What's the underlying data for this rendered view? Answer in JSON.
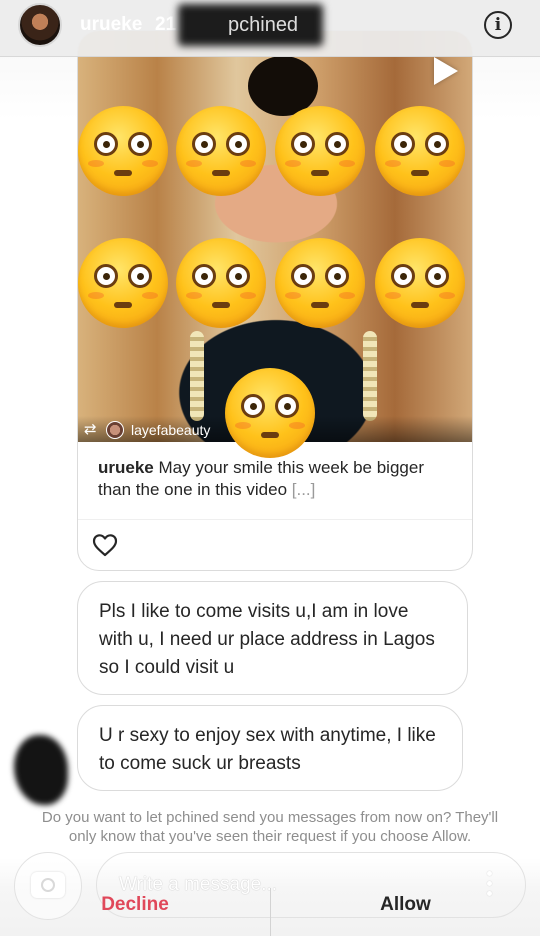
{
  "header": {
    "username": "urueke",
    "time": "21 h",
    "redacted_name": "pchined",
    "info_icon": "info-icon"
  },
  "post": {
    "repost_icon": "repost-icon",
    "reposted_from": "laуefabeauty",
    "caption_user": "urueke",
    "caption_text": "May your smile this week be bigger than the one in this video",
    "caption_more": "[...]",
    "overlay_emoji": "flushed-face-emoji",
    "overlay_emoji_count": 9
  },
  "messages": [
    {
      "text": "Pls I like to come visits u,I am in love with u, I need ur place address in Lagos so I could visit u"
    },
    {
      "text": "U r sexy to enjoy sex with anytime, I like to come suck ur breasts"
    }
  ],
  "request": {
    "prompt": "Do you want to let pchined send you messages from now on? They'll only know that you've seen their request if you choose Allow.",
    "decline_label": "Decline",
    "allow_label": "Allow"
  },
  "composer": {
    "placeholder": "Write a message..."
  },
  "colors": {
    "decline": "#e0485a",
    "text": "#262626",
    "muted": "#8e8e8e",
    "border": "#dbdbdb"
  }
}
